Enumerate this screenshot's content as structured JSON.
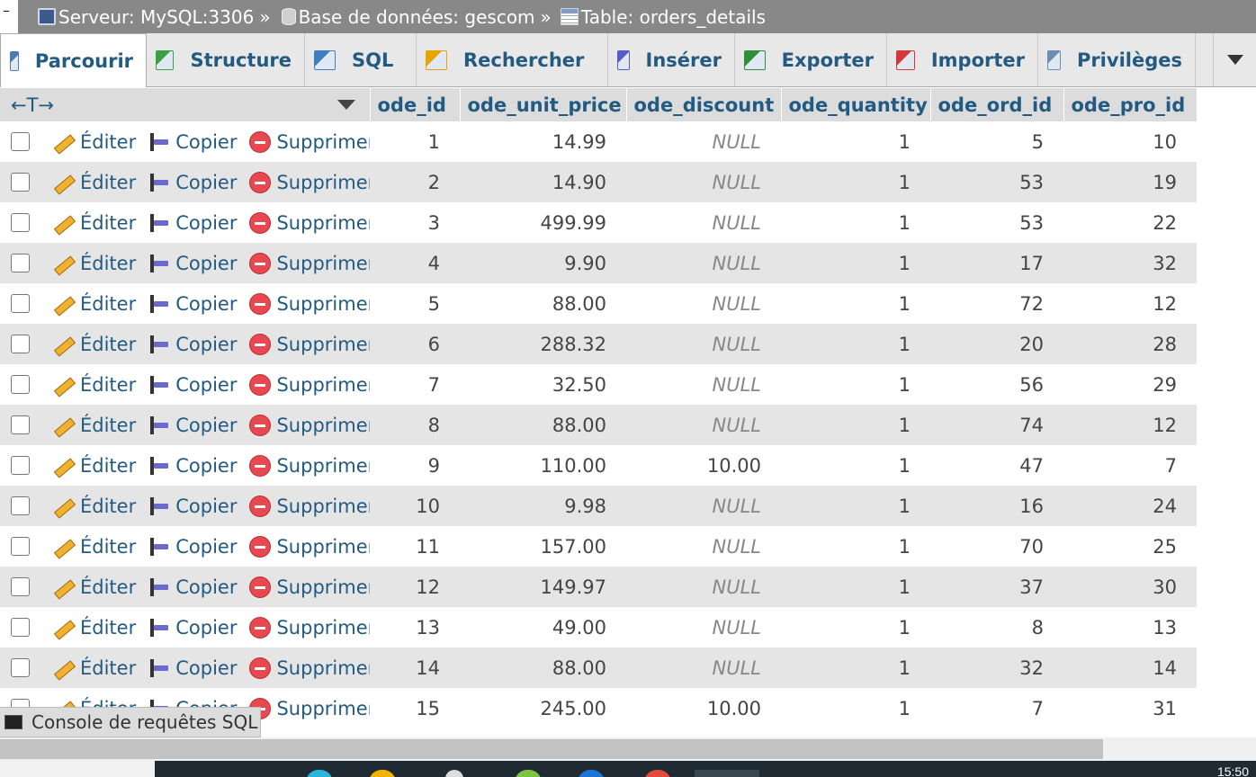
{
  "breadcrumb": {
    "server": "Serveur: MySQL:3306",
    "database": "Base de données: gescom",
    "table": "Table: orders_details",
    "separator": "»"
  },
  "tabs": [
    {
      "label": "Parcourir",
      "icon": "browse-icon",
      "active": true
    },
    {
      "label": "Structure",
      "icon": "structure-icon"
    },
    {
      "label": "SQL",
      "icon": "sql-icon"
    },
    {
      "label": "Rechercher",
      "icon": "search-icon"
    },
    {
      "label": "Insérer",
      "icon": "insert-icon"
    },
    {
      "label": "Exporter",
      "icon": "export-icon"
    },
    {
      "label": "Importer",
      "icon": "import-icon"
    },
    {
      "label": "Privilèges",
      "icon": "privileges-icon"
    }
  ],
  "grid": {
    "column_control": "←T→",
    "columns": [
      "ode_id",
      "ode_unit_price",
      "ode_discount",
      "ode_quantity",
      "ode_ord_id",
      "ode_pro_id"
    ],
    "actions": {
      "edit": "Éditer",
      "copy": "Copier",
      "delete": "Supprimer"
    },
    "rows": [
      [
        "1",
        "14.99",
        "NULL",
        "1",
        "5",
        "10"
      ],
      [
        "2",
        "14.90",
        "NULL",
        "1",
        "53",
        "19"
      ],
      [
        "3",
        "499.99",
        "NULL",
        "1",
        "53",
        "22"
      ],
      [
        "4",
        "9.90",
        "NULL",
        "1",
        "17",
        "32"
      ],
      [
        "5",
        "88.00",
        "NULL",
        "1",
        "72",
        "12"
      ],
      [
        "6",
        "288.32",
        "NULL",
        "1",
        "20",
        "28"
      ],
      [
        "7",
        "32.50",
        "NULL",
        "1",
        "56",
        "29"
      ],
      [
        "8",
        "88.00",
        "NULL",
        "1",
        "74",
        "12"
      ],
      [
        "9",
        "110.00",
        "10.00",
        "1",
        "47",
        "7"
      ],
      [
        "10",
        "9.98",
        "NULL",
        "1",
        "16",
        "24"
      ],
      [
        "11",
        "157.00",
        "NULL",
        "1",
        "70",
        "25"
      ],
      [
        "12",
        "149.97",
        "NULL",
        "1",
        "37",
        "30"
      ],
      [
        "13",
        "49.00",
        "NULL",
        "1",
        "8",
        "13"
      ],
      [
        "14",
        "88.00",
        "NULL",
        "1",
        "32",
        "14"
      ],
      [
        "15",
        "245.00",
        "10.00",
        "1",
        "7",
        "31"
      ]
    ]
  },
  "console": {
    "label": "Console de requêtes SQL"
  },
  "taskbar": {
    "clock": "15:50"
  }
}
